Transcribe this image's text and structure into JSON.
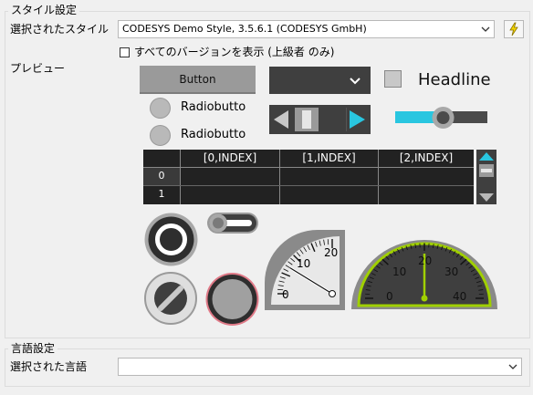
{
  "style_group": {
    "title": "スタイル設定",
    "selected_style_label": "選択されたスタイル",
    "selected_style_value": "CODESYS Demo Style, 3.5.6.1 (CODESYS GmbH)",
    "show_all_versions_label": "すべてのバージョンを表示 (上級者 のみ)",
    "show_all_versions_checked": false,
    "preview_label": "プレビュー"
  },
  "preview": {
    "button_label": "Button",
    "radio_1_label": "Radiobutto",
    "radio_2_label": "Radiobutto",
    "headline_label": "Headline",
    "slider_level": 0.52,
    "table": {
      "headers": [
        "[0,INDEX]",
        "[1,INDEX]",
        "[2,INDEX]"
      ],
      "row_indices": [
        "0",
        "1"
      ]
    },
    "gauge_small": {
      "ticks": [
        "0",
        "10",
        "20"
      ],
      "pointer_value": 7
    },
    "gauge_large": {
      "ticks": [
        "0",
        "10",
        "20",
        "30",
        "40"
      ],
      "pointer_value": 20
    }
  },
  "language_group": {
    "title": "言語設定",
    "selected_language_label": "選択された言語",
    "selected_language_value": ""
  },
  "colors": {
    "accent": "#29c6e0",
    "gauge_green": "#a0d000",
    "widget_dark": "#3f3f3f",
    "widget_gray": "#9a9a9a"
  },
  "icons": [
    "chevron-down-icon",
    "lightning-icon",
    "triangle-left-icon",
    "triangle-right-icon",
    "scroll-up-icon",
    "scroll-down-icon"
  ]
}
